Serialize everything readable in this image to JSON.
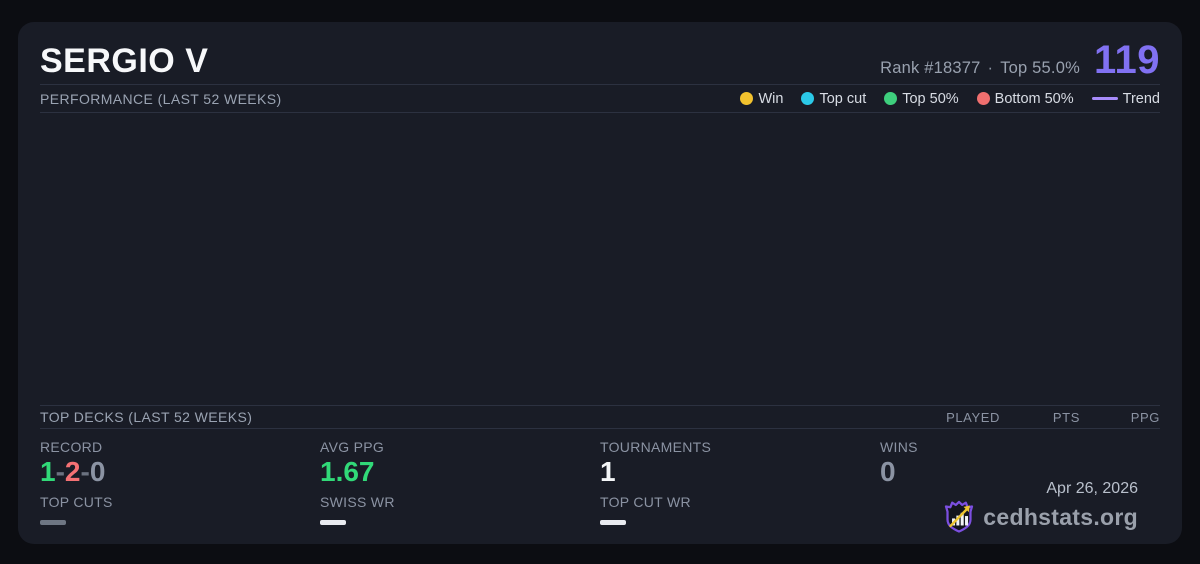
{
  "header": {
    "player_name": "SERGIO V",
    "rank_text": "Rank #18377",
    "separator": "·",
    "top_percent": "Top 55.0%",
    "score": "119",
    "score_color": "#8171f2"
  },
  "performance": {
    "title": "PERFORMANCE (LAST 52 WEEKS)",
    "legend": [
      {
        "label": "Win",
        "color": "#f2c22e"
      },
      {
        "label": "Top cut",
        "color": "#2bc9e8"
      },
      {
        "label": "Top 50%",
        "color": "#3ecf7d"
      },
      {
        "label": "Bottom 50%",
        "color": "#f06f6f"
      }
    ],
    "trend_label": "Trend",
    "trend_color": "#a78bfa",
    "chart_empty": true
  },
  "top_decks": {
    "title": "TOP DECKS (LAST 52 WEEKS)",
    "columns": [
      "PLAYED",
      "PTS",
      "PPG"
    ],
    "rows": []
  },
  "stats": {
    "record": {
      "label": "RECORD",
      "wins": "1",
      "losses": "2",
      "draws": "0",
      "separator": "-",
      "win_color": "#31d978",
      "loss_color": "#f47174",
      "draw_color": "#8b93a3"
    },
    "avg_ppg": {
      "label": "AVG PPG",
      "value": "1.67",
      "color": "#31d978"
    },
    "tournaments": {
      "label": "TOURNAMENTS",
      "value": "1"
    },
    "wins": {
      "label": "WINS",
      "value": "0",
      "color": "#8b93a3"
    },
    "top_cuts": {
      "label": "TOP CUTS",
      "value_dash_color": "#6e7683"
    },
    "swiss_wr": {
      "label": "SWISS WR",
      "value_dash_color": "#e9ebf0"
    },
    "top_cut_wr": {
      "label": "TOP CUT WR",
      "value_dash_color": "#e9ebf0"
    }
  },
  "footer": {
    "date": "Apr 26, 2026",
    "brand": "cedhstats.org"
  }
}
